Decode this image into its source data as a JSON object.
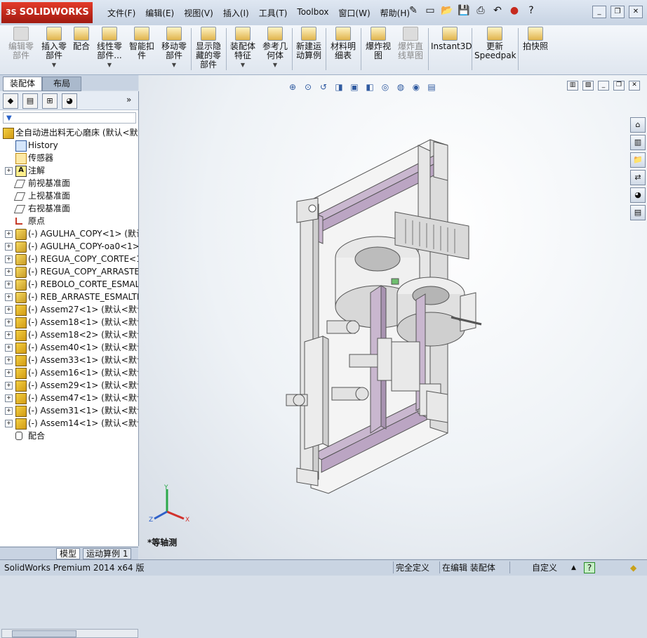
{
  "app": {
    "logo_text": "SOLIDWORKS",
    "logo_prefix": "3S"
  },
  "menu": [
    "文件(F)",
    "编辑(E)",
    "视图(V)",
    "插入(I)",
    "工具(T)",
    "Toolbox",
    "窗口(W)",
    "帮助(H)"
  ],
  "ribbon": {
    "edit_component": "编辑零\n部件",
    "insert_component": "插入零\n部件",
    "mate": "配合",
    "linear_pattern": "线性零\n部件...",
    "smart_fasteners": "智能扣\n件",
    "move_component": "移动零\n部件",
    "show_hidden": "显示隐\n藏的零\n部件",
    "assembly_features": "装配体\n特征",
    "reference_geometry": "参考几\n何体",
    "new_motion_study": "新建运\n动算例",
    "bom": "材料明\n细表",
    "exploded_view": "爆炸视\n图",
    "explode_line_sketch": "爆炸直\n线草图",
    "instant3d": "Instant3D",
    "update_speedpak": "更新\nSpeedpak",
    "snapshot": "拍快照"
  },
  "left_tabs": {
    "assembly": "装配体",
    "layout": "布局"
  },
  "panel": {
    "expand_label": "»",
    "filter_label": "▼"
  },
  "tree": [
    {
      "label": "全自动进出料无心磨床  (默认<默",
      "type": "root"
    },
    {
      "label": "History",
      "type": "hist"
    },
    {
      "label": "传感器",
      "type": "sensor"
    },
    {
      "label": "注解",
      "type": "anno"
    },
    {
      "label": "前视基准面",
      "type": "plane"
    },
    {
      "label": "上视基准面",
      "type": "plane"
    },
    {
      "label": "右视基准面",
      "type": "plane"
    },
    {
      "label": "原点",
      "type": "origin"
    },
    {
      "label": "(-) AGULHA_COPY<1> (默认<<",
      "type": "part"
    },
    {
      "label": "(-) AGULHA_COPY-oa0<1> (默",
      "type": "part"
    },
    {
      "label": "(-) REGUA_COPY_CORTE<1> (默",
      "type": "part"
    },
    {
      "label": "(-) REGUA_COPY_ARRASTE<1>",
      "type": "part"
    },
    {
      "label": "(-) REBOLO_CORTE_ESMALTEC",
      "type": "part"
    },
    {
      "label": "(-) REB_ARRASTE_ESMALTEC<",
      "type": "part"
    },
    {
      "label": "(-) Assem27<1> (默认<默认_5",
      "type": "asm"
    },
    {
      "label": "(-) Assem18<1> (默认<默认_5",
      "type": "asm"
    },
    {
      "label": "(-) Assem18<2> (默认<默认_5",
      "type": "asm"
    },
    {
      "label": "(-) Assem40<1> (默认<默认_5",
      "type": "asm"
    },
    {
      "label": "(-) Assem33<1> (默认<默认_5",
      "type": "asm"
    },
    {
      "label": "(-) Assem16<1> (默认<默认_5",
      "type": "asm"
    },
    {
      "label": "(-) Assem29<1> (默认<默认_5",
      "type": "asm"
    },
    {
      "label": "(-) Assem47<1> (默认<默认_5",
      "type": "asm"
    },
    {
      "label": "(-) Assem31<1> (默认<默认_5",
      "type": "asm"
    },
    {
      "label": "(-) Assem14<1> (默认<默认_5",
      "type": "asm"
    },
    {
      "label": "配合",
      "type": "mate"
    }
  ],
  "bottom_tabs": {
    "model": "模型",
    "motion": "运动算例 1"
  },
  "viewport": {
    "view_name": "*等轴测",
    "axis_x": "X",
    "axis_y": "Y",
    "axis_z": "Z"
  },
  "status": {
    "product": "SolidWorks Premium 2014 x64 版",
    "defined": "完全定义",
    "editing": "在编辑 装配体",
    "units": "自定义",
    "help": "?"
  }
}
